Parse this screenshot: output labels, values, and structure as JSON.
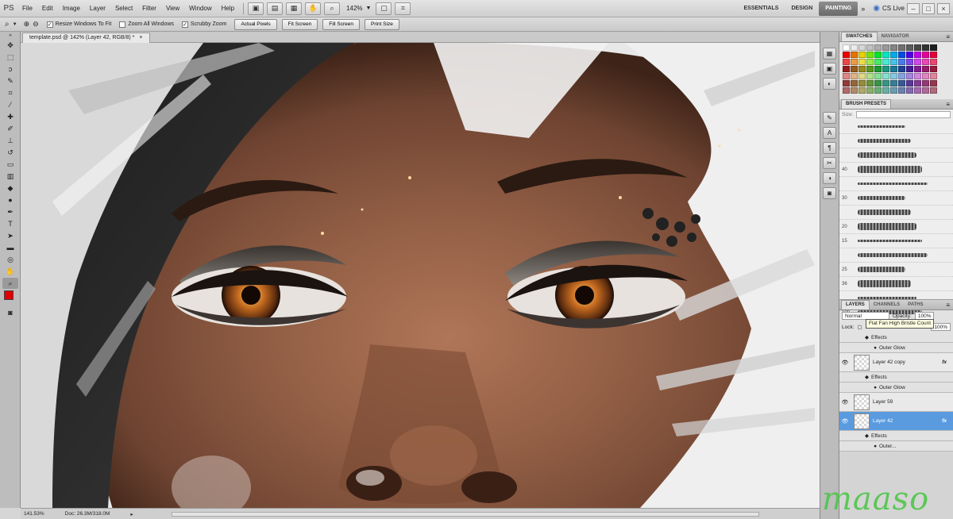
{
  "app": {
    "logo": "PS"
  },
  "menu": [
    "File",
    "Edit",
    "Image",
    "Layer",
    "Select",
    "Filter",
    "View",
    "Window",
    "Help"
  ],
  "menubar": {
    "zoom": "142%",
    "workspaces": [
      "ESSENTIALS",
      "DESIGN",
      "PAINTING"
    ],
    "active_workspace": "PAINTING",
    "cs_live": "CS Live"
  },
  "options": {
    "checkboxes": [
      "Resize Windows To Fit",
      "Zoom All Windows",
      "Scrubby Zoom"
    ],
    "buttons": [
      "Actual Pixels",
      "Fit Screen",
      "Fill Screen",
      "Print Size"
    ]
  },
  "document": {
    "tab_title": "template.psd @ 142% (Layer 42, RGB/8) *",
    "tab_close": "×"
  },
  "status": {
    "zoom": "141.53%",
    "doc": "Doc: 26.3M/318.0M"
  },
  "colors": {
    "foreground": "#e00000",
    "background": "#ffffff",
    "active_layer": "#5a9be0",
    "watermark": "#4fc64a"
  },
  "panels": {
    "swatches": {
      "tabs": [
        "SWATCHES",
        "NAVIGATOR"
      ]
    },
    "brush_presets": {
      "tabs": [
        "BRUSH PRESETS"
      ],
      "size_label": "Size:",
      "brushes": [
        "",
        "",
        "",
        "40",
        "",
        "30",
        "",
        "20",
        "15",
        "",
        "25",
        "36",
        "",
        "100"
      ],
      "tooltip": "Flat Fan High Bristle Count"
    },
    "layers": {
      "tabs": [
        "LAYERS",
        "CHANNELS",
        "PATHS"
      ],
      "blend_mode": "Normal",
      "opacity_label": "Opacity:",
      "opacity": "100%",
      "lock_label": "Lock:",
      "fill_label": "Fill:",
      "fill": "100%",
      "items": [
        {
          "kind": "sub",
          "name": "Effects"
        },
        {
          "kind": "sub2",
          "name": "Outer Glow"
        },
        {
          "kind": "layer",
          "name": "Layer 42 copy",
          "fx": "fx"
        },
        {
          "kind": "sub",
          "name": "Effects"
        },
        {
          "kind": "sub2",
          "name": "Outer Glow"
        },
        {
          "kind": "layer",
          "name": "Layer 59",
          "fx": ""
        },
        {
          "kind": "layer-active",
          "name": "Layer 42",
          "fx": "fx"
        },
        {
          "kind": "sub",
          "name": "Effects"
        },
        {
          "kind": "sub2",
          "name": "Outer..."
        }
      ]
    }
  },
  "watermark": "maaso"
}
